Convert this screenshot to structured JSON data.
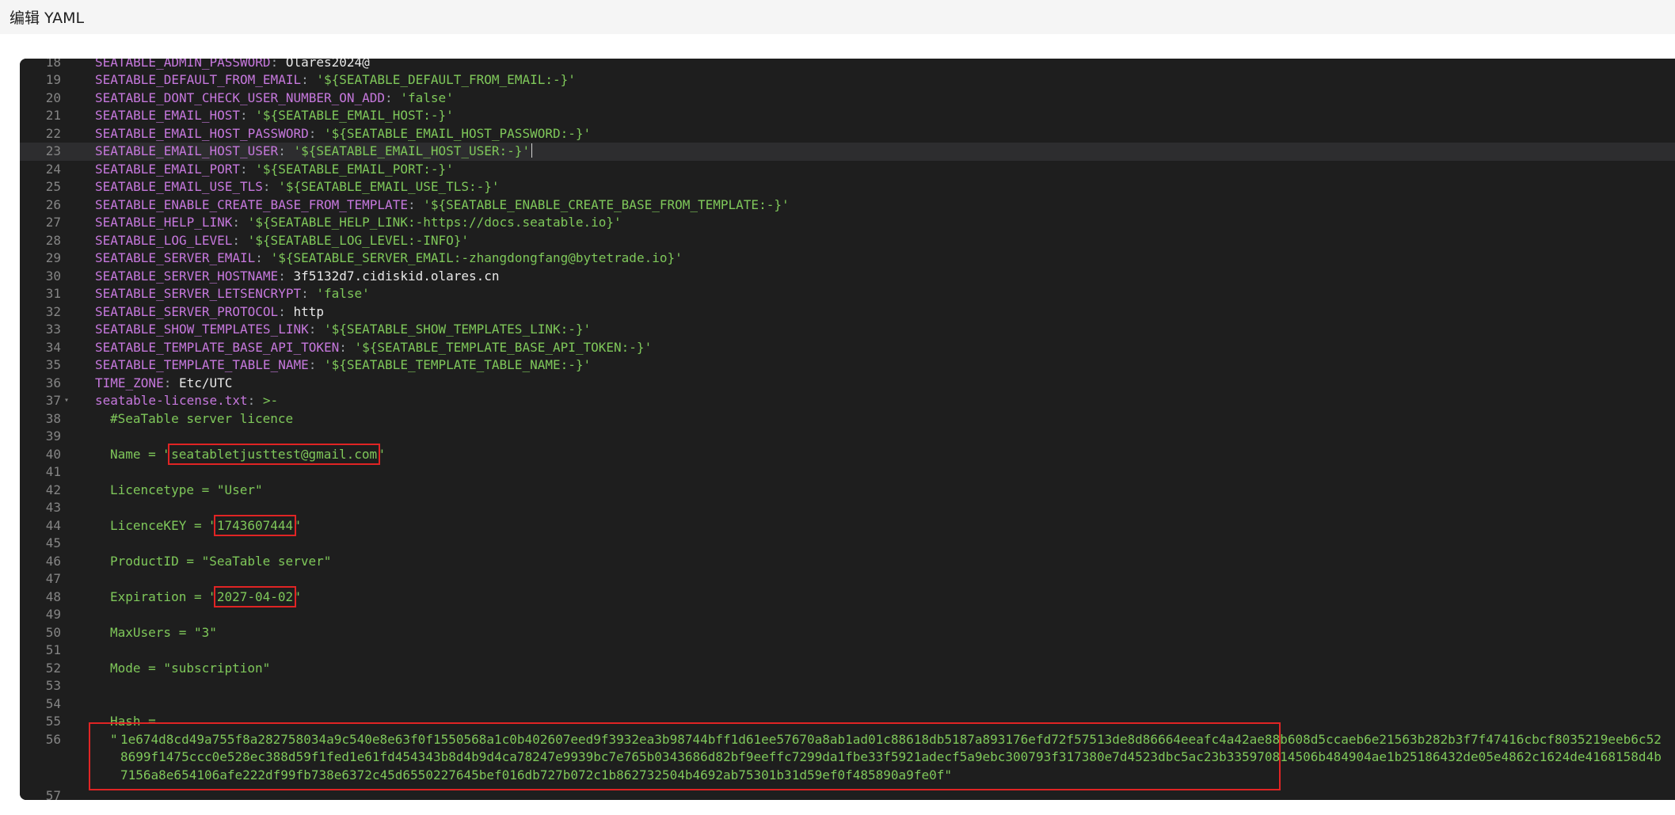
{
  "header": {
    "title": "编辑 YAML"
  },
  "editor": {
    "lines": [
      {
        "num": "18",
        "key": "SEATABLE_ADMIN_PASSWORD",
        "value": "Olares2024@",
        "vtype": "plain"
      },
      {
        "num": "19",
        "key": "SEATABLE_DEFAULT_FROM_EMAIL",
        "value": "'${SEATABLE_DEFAULT_FROM_EMAIL:-}'",
        "vtype": "string"
      },
      {
        "num": "20",
        "key": "SEATABLE_DONT_CHECK_USER_NUMBER_ON_ADD",
        "value": "'false'",
        "vtype": "string"
      },
      {
        "num": "21",
        "key": "SEATABLE_EMAIL_HOST",
        "value": "'${SEATABLE_EMAIL_HOST:-}'",
        "vtype": "string"
      },
      {
        "num": "22",
        "key": "SEATABLE_EMAIL_HOST_PASSWORD",
        "value": "'${SEATABLE_EMAIL_HOST_PASSWORD:-}'",
        "vtype": "string"
      },
      {
        "num": "23",
        "key": "SEATABLE_EMAIL_HOST_USER",
        "value": "'${SEATABLE_EMAIL_HOST_USER:-}'",
        "vtype": "string"
      },
      {
        "num": "24",
        "key": "SEATABLE_EMAIL_PORT",
        "value": "'${SEATABLE_EMAIL_PORT:-}'",
        "vtype": "string"
      },
      {
        "num": "25",
        "key": "SEATABLE_EMAIL_USE_TLS",
        "value": "'${SEATABLE_EMAIL_USE_TLS:-}'",
        "vtype": "string"
      },
      {
        "num": "26",
        "key": "SEATABLE_ENABLE_CREATE_BASE_FROM_TEMPLATE",
        "value": "'${SEATABLE_ENABLE_CREATE_BASE_FROM_TEMPLATE:-}'",
        "vtype": "string"
      },
      {
        "num": "27",
        "key": "SEATABLE_HELP_LINK",
        "value": "'${SEATABLE_HELP_LINK:-https://docs.seatable.io}'",
        "vtype": "string"
      },
      {
        "num": "28",
        "key": "SEATABLE_LOG_LEVEL",
        "value": "'${SEATABLE_LOG_LEVEL:-INFO}'",
        "vtype": "string"
      },
      {
        "num": "29",
        "key": "SEATABLE_SERVER_EMAIL",
        "value": "'${SEATABLE_SERVER_EMAIL:-zhangdongfang@bytetrade.io}'",
        "vtype": "string"
      },
      {
        "num": "30",
        "key": "SEATABLE_SERVER_HOSTNAME",
        "value": "3f5132d7.cidiskid.olares.cn",
        "vtype": "plain"
      },
      {
        "num": "31",
        "key": "SEATABLE_SERVER_LETSENCRYPT",
        "value": "'false'",
        "vtype": "string"
      },
      {
        "num": "32",
        "key": "SEATABLE_SERVER_PROTOCOL",
        "value": "http",
        "vtype": "plain"
      },
      {
        "num": "33",
        "key": "SEATABLE_SHOW_TEMPLATES_LINK",
        "value": "'${SEATABLE_SHOW_TEMPLATES_LINK:-}'",
        "vtype": "string"
      },
      {
        "num": "34",
        "key": "SEATABLE_TEMPLATE_BASE_API_TOKEN",
        "value": "'${SEATABLE_TEMPLATE_BASE_API_TOKEN:-}'",
        "vtype": "string"
      },
      {
        "num": "35",
        "key": "SEATABLE_TEMPLATE_TABLE_NAME",
        "value": "'${SEATABLE_TEMPLATE_TABLE_NAME:-}'",
        "vtype": "string"
      },
      {
        "num": "36",
        "key": "TIME_ZONE",
        "value": "Etc/UTC",
        "vtype": "plain"
      },
      {
        "num": "37",
        "key": "seatable-license.txt",
        "value": ">-",
        "vtype": "string"
      }
    ],
    "license": [
      {
        "num": "38",
        "text": "#SeaTable server licence"
      },
      {
        "num": "39",
        "text": ""
      },
      {
        "num": "40",
        "prefix": "Name = \"",
        "value": "seatabletjusttest@gmail.com",
        "suffix": "\""
      },
      {
        "num": "41",
        "text": ""
      },
      {
        "num": "42",
        "text": "Licencetype = \"User\""
      },
      {
        "num": "43",
        "text": ""
      },
      {
        "num": "44",
        "prefix": "LicenceKEY = \"",
        "value": "1743607444",
        "suffix": "\""
      },
      {
        "num": "45",
        "text": ""
      },
      {
        "num": "46",
        "text": "ProductID = \"SeaTable server\""
      },
      {
        "num": "47",
        "text": ""
      },
      {
        "num": "48",
        "prefix": "Expiration = \"",
        "value": "2027-04-02",
        "suffix": "\""
      },
      {
        "num": "49",
        "text": ""
      },
      {
        "num": "50",
        "text": "MaxUsers = \"3\""
      },
      {
        "num": "51",
        "text": ""
      },
      {
        "num": "52",
        "text": "Mode = \"subscription\""
      },
      {
        "num": "53",
        "text": ""
      },
      {
        "num": "54",
        "text": ""
      },
      {
        "num": "55",
        "text": "Hash ="
      }
    ],
    "hash_line_num": "56",
    "hash_open_quote": "\"",
    "hash_value": "1e674d8cd49a755f8a282758034a9c540e8e63f0f1550568a1c0b402607eed9f3932ea3b98744bff1d61ee57670a8ab1ad01c88618db5187a893176efd72f57513de8d86664eeafc4a42ae88b608d5ccaeb6e21563b282b3f7f47416cbcf8035219eeb6c528699f1475ccc0e528ec388d59f1fed1e61fd454343b8d4b9d4ca78247e9939bc7e765b0343686d82bf9eeffc7299da1fbe33f5921adecf5a9ebc300793f317380e7d4523dbc5ac23b335970814506b484904ae1b25186432de05e4862c1624de4168158d4b7156a8e654106afe222df99fb738e6372c45d6550227645bef016db727b072c1b862732504b4692ab75301b31d59ef0f485890a9fe0f\"",
    "last_line_num": "57",
    "colors": {
      "key": "#c678dd",
      "string": "#7fc85a",
      "plain": "#e8e8e8",
      "highlight": "#e02424"
    }
  }
}
